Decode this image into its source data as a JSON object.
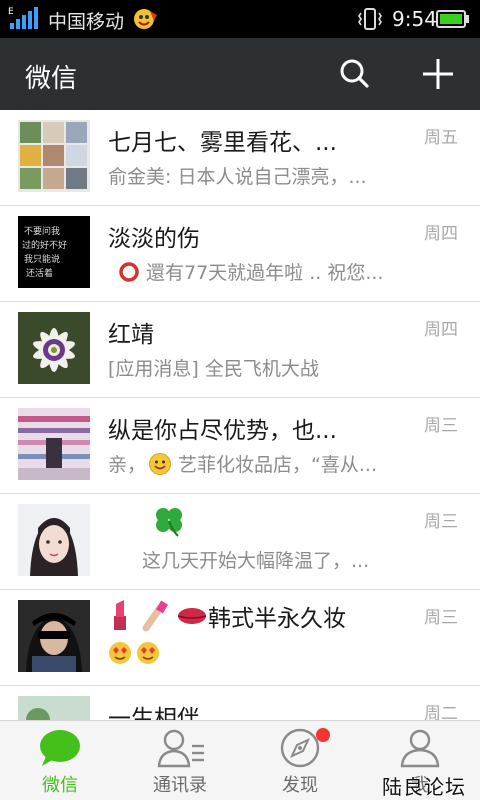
{
  "status_bar": {
    "carrier": "中国移动",
    "time": "9:54",
    "net_badge": "E"
  },
  "header": {
    "title": "微信",
    "search_icon": "search-icon",
    "add_icon": "plus-icon"
  },
  "chats": [
    {
      "name": "七月七、雾里看花、...",
      "preview": "俞金美: 日本人说自己漂亮，...",
      "time": "周五"
    },
    {
      "name": "淡淡的伤",
      "preview": "還有77天就過年啦 .. 祝您...",
      "time": "周四",
      "icon": "hollow-red-circle-emoji"
    },
    {
      "name": "红靖",
      "preview": "[应用消息] 全民飞机大战",
      "time": "周四"
    },
    {
      "name": "纵是你占尽优势，也...",
      "preview_prefix": "亲，",
      "preview": "艺菲化妆品店，“喜从...",
      "time": "周三",
      "icon": "smiley-emoji"
    },
    {
      "name": "",
      "preview": "这几天开始大幅降温了，...",
      "time": "周三",
      "icon": "four-leaf-clover-emoji"
    },
    {
      "name": "韩式半永久妆",
      "preview": "",
      "time": "周三",
      "icon": "lipstick-nail-polish-lips-emoji"
    },
    {
      "name": "一生相伴",
      "preview": "",
      "time": "周二"
    }
  ],
  "avatar_text": "不要问我过的好不好我只能说还活着",
  "bottom_nav": [
    {
      "label": "微信",
      "icon": "chat-bubble-icon",
      "active": true
    },
    {
      "label": "通讯录",
      "icon": "contacts-icon",
      "active": false
    },
    {
      "label": "发现",
      "icon": "compass-icon",
      "active": false,
      "badge": true
    },
    {
      "label": "我",
      "icon": "person-icon",
      "active": false
    }
  ],
  "watermark": "陆良论坛",
  "colors": {
    "header_bg": "#2d3033",
    "accent_green": "#45c01a",
    "badge_red": "#f43530"
  }
}
